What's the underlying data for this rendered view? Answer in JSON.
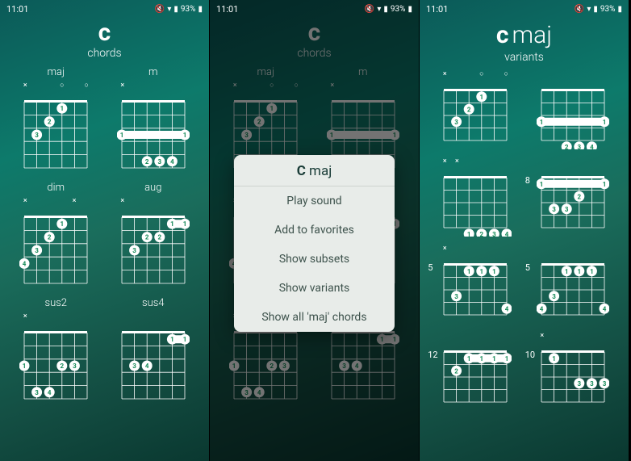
{
  "status": {
    "time": "11:01",
    "battery": "93%"
  },
  "panels": [
    {
      "title_main": "c",
      "title_sub": "chords",
      "chords": [
        {
          "label": "maj",
          "marks": [
            "×",
            "",
            "",
            "○",
            "",
            "○"
          ],
          "fingers": [
            [
              4,
              1,
              "1"
            ],
            [
              3,
              2,
              "2"
            ],
            [
              2,
              3,
              "3"
            ]
          ]
        },
        {
          "label": "m",
          "marks": [
            "×",
            "",
            "",
            "",
            "",
            ""
          ],
          "fingers": [
            [
              1,
              3,
              "1"
            ],
            [
              6,
              3,
              "1"
            ],
            [
              3,
              5,
              "2"
            ],
            [
              4,
              5,
              "3"
            ],
            [
              5,
              5,
              "4"
            ]
          ],
          "barre": {
            "fret": 3,
            "from": 1,
            "to": 6
          }
        },
        {
          "label": "dim",
          "marks": [
            "×",
            "",
            "",
            "",
            "×",
            ""
          ],
          "fingers": [
            [
              4,
              1,
              "1"
            ],
            [
              3,
              2,
              "2"
            ],
            [
              2,
              3,
              "3"
            ],
            [
              1,
              4,
              "4"
            ]
          ]
        },
        {
          "label": "aug",
          "marks": [
            "×",
            "",
            "",
            "",
            "",
            ""
          ],
          "fingers": [
            [
              5,
              1,
              "1"
            ],
            [
              6,
              1,
              "1"
            ],
            [
              3,
              2,
              "2"
            ],
            [
              4,
              2,
              "2"
            ],
            [
              2,
              3,
              "3"
            ]
          ],
          "barre": {
            "fret": 1,
            "from": 5,
            "to": 6
          }
        },
        {
          "label": "sus2",
          "marks": [
            "×",
            "",
            "",
            "",
            "",
            ""
          ],
          "fingers": [
            [
              1,
              3,
              "1"
            ],
            [
              4,
              3,
              "2"
            ],
            [
              5,
              3,
              "3"
            ],
            [
              2,
              5,
              "3"
            ],
            [
              3,
              5,
              "4"
            ]
          ]
        },
        {
          "label": "sus4",
          "marks": [
            "",
            "",
            "",
            "",
            "",
            ""
          ],
          "fingers": [
            [
              5,
              1,
              "1"
            ],
            [
              6,
              1,
              "1"
            ],
            [
              2,
              3,
              "3"
            ],
            [
              3,
              3,
              "4"
            ]
          ],
          "barre": {
            "fret": 1,
            "from": 5,
            "to": 6
          }
        }
      ]
    },
    {
      "title_main": "c",
      "title_sub": "chords",
      "dim": true,
      "popup": {
        "title_bold": "C",
        "title_rest": "maj",
        "items": [
          "Play sound",
          "Add to favorites",
          "Show subsets",
          "Show variants",
          "Show all 'maj' chords"
        ]
      }
    },
    {
      "title_main": "c",
      "title_maj": "maj",
      "title_sub": "variants",
      "variants": [
        {
          "pos": "",
          "marks": [
            "×",
            "",
            "",
            "○",
            "",
            "○"
          ],
          "fingers": [
            [
              4,
              1,
              "1"
            ],
            [
              3,
              2,
              "2"
            ],
            [
              2,
              3,
              "3"
            ]
          ]
        },
        {
          "pos": "",
          "marks": [
            "",
            "",
            "",
            "",
            "",
            ""
          ],
          "fingers": [
            [
              1,
              3,
              "1"
            ],
            [
              6,
              3,
              "1"
            ],
            [
              3,
              5,
              "2"
            ],
            [
              4,
              5,
              "3"
            ],
            [
              5,
              5,
              "4"
            ]
          ],
          "barre": {
            "fret": 3,
            "from": 1,
            "to": 6
          }
        },
        {
          "pos": "",
          "marks": [
            "×",
            "×",
            "",
            "",
            "",
            ""
          ],
          "fingers": [
            [
              3,
              5,
              "1"
            ],
            [
              4,
              5,
              "2"
            ],
            [
              5,
              5,
              "3"
            ],
            [
              6,
              5,
              "4"
            ]
          ]
        },
        {
          "pos": "8",
          "marks": [
            "",
            "",
            "",
            "",
            "",
            ""
          ],
          "fingers": [
            [
              1,
              1,
              "1"
            ],
            [
              6,
              1,
              "1"
            ],
            [
              4,
              2,
              "2"
            ],
            [
              2,
              3,
              "3"
            ],
            [
              3,
              3,
              "3"
            ]
          ],
          "barre": {
            "fret": 1,
            "from": 1,
            "to": 6
          }
        },
        {
          "pos": "5",
          "marks": [
            "×",
            "",
            "",
            "",
            "",
            ""
          ],
          "fingers": [
            [
              3,
              1,
              "1"
            ],
            [
              4,
              1,
              "1"
            ],
            [
              5,
              1,
              "1"
            ],
            [
              2,
              3,
              "3"
            ],
            [
              6,
              4,
              "4"
            ]
          ]
        },
        {
          "pos": "5",
          "marks": [
            "",
            "",
            "",
            "",
            "",
            ""
          ],
          "fingers": [
            [
              3,
              1,
              "1"
            ],
            [
              4,
              1,
              "1"
            ],
            [
              5,
              1,
              "1"
            ],
            [
              2,
              3,
              "3"
            ],
            [
              1,
              4,
              "4"
            ],
            [
              6,
              4,
              "4"
            ]
          ]
        },
        {
          "pos": "12",
          "marks": [
            "",
            "",
            "",
            "",
            "",
            ""
          ],
          "fingers": [
            [
              3,
              1,
              "1"
            ],
            [
              4,
              1,
              "1"
            ],
            [
              5,
              1,
              "1"
            ],
            [
              6,
              1,
              "1"
            ],
            [
              2,
              2,
              "2"
            ]
          ],
          "barre": {
            "fret": 1,
            "from": 3,
            "to": 6
          }
        },
        {
          "pos": "10",
          "marks": [
            "×",
            "",
            "",
            "",
            "",
            ""
          ],
          "fingers": [
            [
              2,
              1,
              "1"
            ],
            [
              4,
              3,
              "3"
            ],
            [
              5,
              3,
              "3"
            ],
            [
              6,
              3,
              "3"
            ]
          ]
        }
      ]
    }
  ]
}
